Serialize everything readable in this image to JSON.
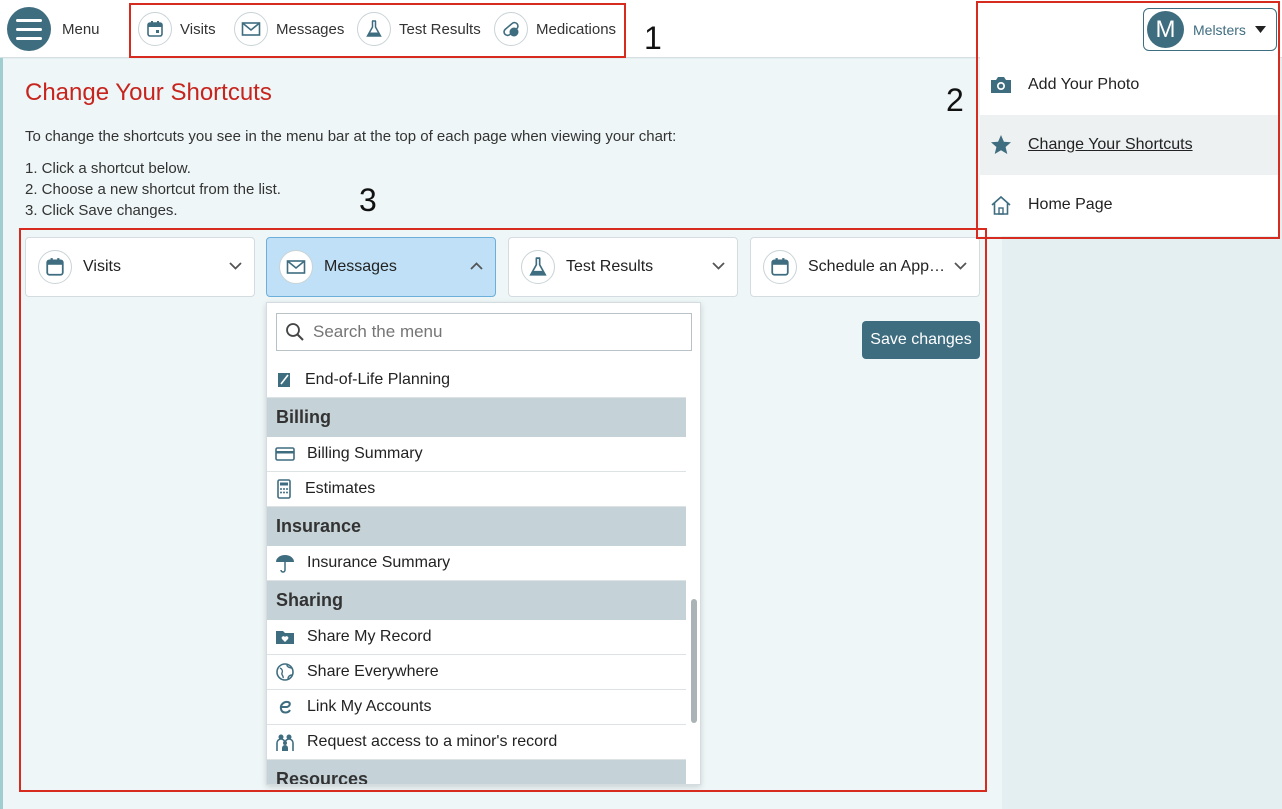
{
  "header": {
    "menu_label": "Menu",
    "shortcuts": [
      {
        "label": "Visits",
        "icon": "calendar-icon"
      },
      {
        "label": "Messages",
        "icon": "envelope-icon"
      },
      {
        "label": "Test Results",
        "icon": "flask-icon"
      },
      {
        "label": "Medications",
        "icon": "pill-icon"
      }
    ],
    "user": {
      "initial": "M",
      "name": "Melsters"
    }
  },
  "annotations": [
    "1",
    "2",
    "3"
  ],
  "user_menu": {
    "items": [
      {
        "label": "Add Your Photo",
        "icon": "camera-icon"
      },
      {
        "label": "Change Your Shortcuts",
        "icon": "star-icon",
        "selected": true
      },
      {
        "label": "Home Page",
        "icon": "home-icon"
      }
    ]
  },
  "page": {
    "title": "Change Your Shortcuts",
    "intro": "To change the shortcuts you see in the menu bar at the top of each page when viewing your chart:",
    "steps": [
      "1. Click a shortcut below.",
      "2. Choose a new shortcut from the list.",
      "3. Click Save changes."
    ],
    "slots": [
      {
        "label": "Visits",
        "icon": "calendar-icon",
        "expanded": false
      },
      {
        "label": "Messages",
        "icon": "envelope-icon",
        "expanded": true
      },
      {
        "label": "Test Results",
        "icon": "flask-icon",
        "expanded": false
      },
      {
        "label": "Schedule an Appointment",
        "icon": "calendar-icon",
        "expanded": false
      }
    ],
    "save_label": "Save changes"
  },
  "dropdown": {
    "search_placeholder": "Search the menu",
    "list": [
      {
        "type": "item",
        "label": "End-of-Life Planning",
        "icon": "document-pen-icon"
      },
      {
        "type": "group",
        "label": "Billing"
      },
      {
        "type": "item",
        "label": "Billing Summary",
        "icon": "credit-card-icon"
      },
      {
        "type": "item",
        "label": "Estimates",
        "icon": "calculator-icon"
      },
      {
        "type": "group",
        "label": "Insurance"
      },
      {
        "type": "item",
        "label": "Insurance Summary",
        "icon": "umbrella-icon"
      },
      {
        "type": "group",
        "label": "Sharing"
      },
      {
        "type": "item",
        "label": "Share My Record",
        "icon": "folder-heart-icon"
      },
      {
        "type": "item",
        "label": "Share Everywhere",
        "icon": "globe-icon"
      },
      {
        "type": "item",
        "label": "Link My Accounts",
        "icon": "link-e-icon"
      },
      {
        "type": "item",
        "label": "Request access to a minor's record",
        "icon": "family-icon"
      },
      {
        "type": "group",
        "label": "Resources"
      }
    ]
  },
  "colors": {
    "accent": "#3f6d80",
    "title_red": "#c7241e",
    "highlight_box": "#d72b20",
    "active_slot": "#bfe0f6"
  }
}
